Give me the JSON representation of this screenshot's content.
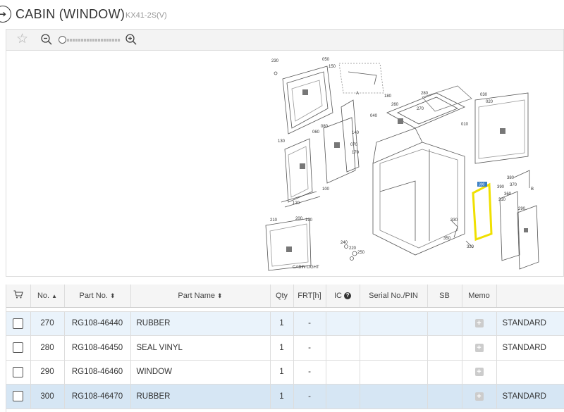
{
  "header": {
    "back_glyph": "➔",
    "title": "CABIN (WINDOW)",
    "model": "KX41-2S(V)"
  },
  "toolbar": {
    "favorite_icon": "star-icon",
    "zoom_out_icon": "zoom-out-icon",
    "zoom_in_icon": "zoom-in-icon",
    "zoom_level": 0.0
  },
  "diagram": {
    "labels": [
      "230",
      "050",
      "150",
      "180",
      "A",
      "040",
      "260",
      "270",
      "280",
      "030",
      "010",
      "020",
      "130",
      "060",
      "080",
      "140",
      "070",
      "170",
      "100",
      "120",
      "210",
      "200",
      "190",
      "CABIN LIGHT",
      "330",
      "350",
      "240",
      "220",
      "250",
      "320",
      "300",
      "390",
      "380",
      "370",
      "360",
      "310",
      "290",
      "B"
    ],
    "highlight_color": "#f0e000",
    "callout_label": "300"
  },
  "table": {
    "columns": {
      "cart_icon": "cart-icon",
      "no": "No.",
      "part_no": "Part No.",
      "part_name": "Part Name",
      "qty": "Qty",
      "frt": "FRT[h]",
      "ic": "IC",
      "serial": "Serial No./PIN",
      "sb": "SB",
      "memo": "Memo",
      "remark": ""
    },
    "rows": [
      {
        "no": "270",
        "part_no": "RG108-46440",
        "part_name": "RUBBER",
        "qty": "1",
        "frt": "-",
        "ic": "",
        "serial": "",
        "sb": "",
        "remark": "STANDARD"
      },
      {
        "no": "280",
        "part_no": "RG108-46450",
        "part_name": "SEAL VINYL",
        "qty": "1",
        "frt": "-",
        "ic": "",
        "serial": "",
        "sb": "",
        "remark": "STANDARD"
      },
      {
        "no": "290",
        "part_no": "RG108-46460",
        "part_name": "WINDOW",
        "qty": "1",
        "frt": "-",
        "ic": "",
        "serial": "",
        "sb": "",
        "remark": ""
      },
      {
        "no": "300",
        "part_no": "RG108-46470",
        "part_name": "RUBBER",
        "qty": "1",
        "frt": "-",
        "ic": "",
        "serial": "",
        "sb": "",
        "remark": "STANDARD"
      }
    ]
  }
}
